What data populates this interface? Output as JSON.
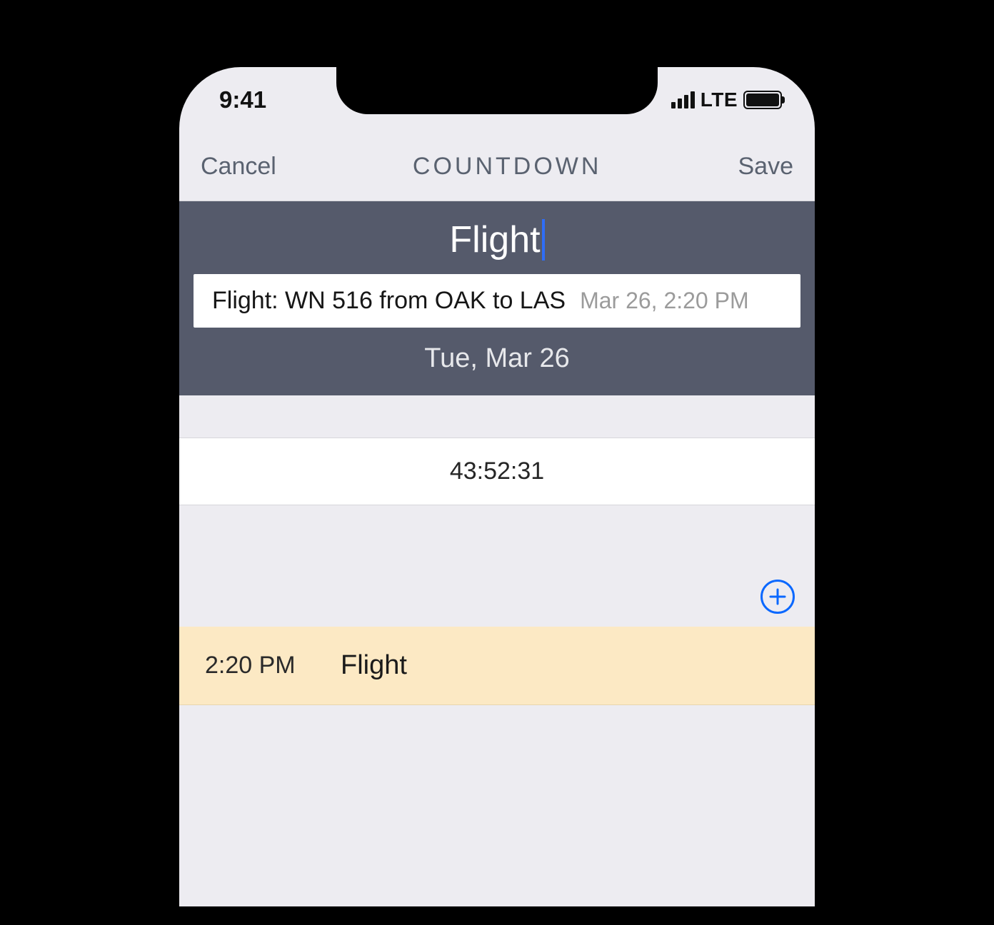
{
  "status": {
    "time": "9:41",
    "network": "LTE"
  },
  "nav": {
    "cancel": "Cancel",
    "title": "COUNTDOWN",
    "save": "Save"
  },
  "hero": {
    "title_value": "Flight",
    "suggestion_main": "Flight: WN 516 from OAK to LAS",
    "suggestion_date": "Mar 26, 2:20 PM",
    "subtitle": "Tue, Mar 26"
  },
  "countdown": {
    "remaining": "43:52:31"
  },
  "event": {
    "time": "2:20 PM",
    "name": "Flight"
  }
}
